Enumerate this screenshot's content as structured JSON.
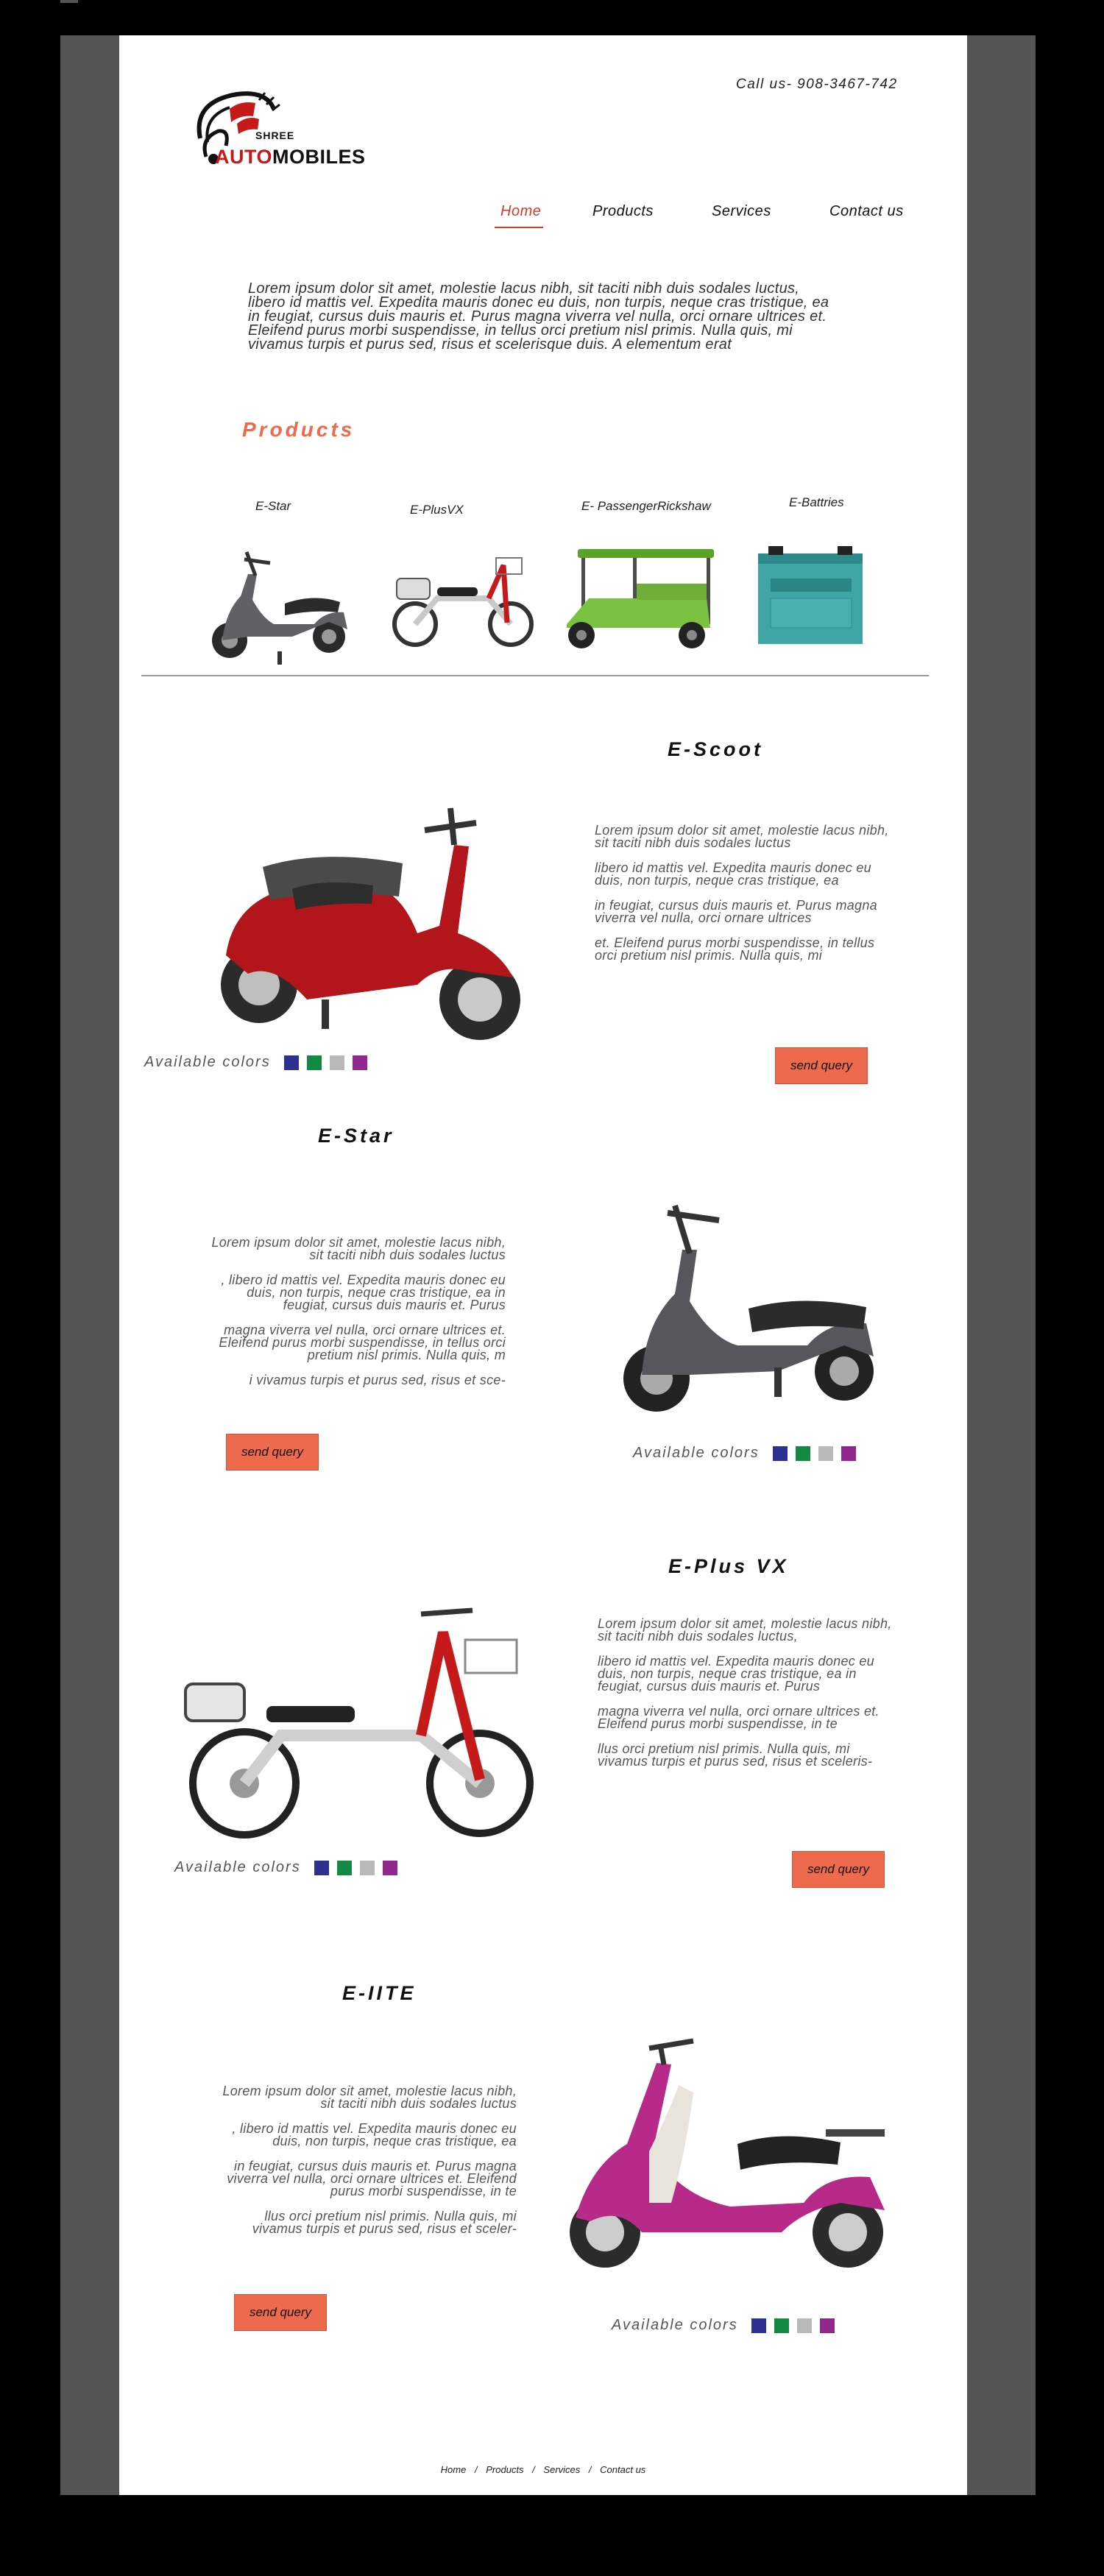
{
  "header": {
    "logo_top": "SHREE",
    "logo_main_red": "AUTO",
    "logo_main_rest": "MOBILES",
    "call": "Call us- 908-3467-742"
  },
  "nav": {
    "items": [
      "Home",
      "Products",
      "Services",
      "Contact us"
    ],
    "active": "Home"
  },
  "intro": "Lorem ipsum dolor sit amet, molestie lacus nibh, sit taciti nibh duis sodales luctus, libero id mattis vel. Expedita mauris donec eu duis, non turpis, neque cras tristique, ea in feugiat, cursus duis mauris et. Purus magna viverra vel nulla, orci ornare ultrices et. Eleifend purus morbi suspendisse, in tellus orci pretium nisl primis. Nulla quis, mi vivamus turpis et purus sed, risus et scelerisque duis. A elementum erat",
  "products": {
    "heading": "Products",
    "items": [
      {
        "label": "E-Star"
      },
      {
        "label": "E-PlusVX"
      },
      {
        "label": "E- PassengerRickshaw"
      },
      {
        "label": "E-Battries"
      }
    ]
  },
  "common": {
    "available_colors": "Available colors",
    "send_query": "send query",
    "swatch_colors": [
      "#2e3192",
      "#138a43",
      "#b9b9b9",
      "#92278f"
    ]
  },
  "sections": {
    "escoot": {
      "title": "E-Scoot",
      "paragraphs": [
        "Lorem ipsum dolor sit amet, molestie lacus nibh, sit taciti nibh duis sodales luctus",
        "libero id mattis vel. Expedita mauris donec eu duis, non turpis, neque cras tristique, ea",
        "in feugiat, cursus duis mauris et. Purus magna viverra vel nulla, orci ornare ultrices",
        "et. Eleifend purus morbi suspendisse, in tellus orci pretium nisl primis. Nulla quis, mi"
      ]
    },
    "estar": {
      "title": "E-Star",
      "paragraphs": [
        "Lorem ipsum dolor sit amet, molestie lacus nibh, sit taciti nibh duis sodales luctus",
        ", libero id mattis vel. Expedita mauris donec eu duis, non turpis, neque cras tristique, ea in feugiat, cursus duis mauris et. Purus",
        "magna viverra vel nulla, orci ornare ultrices et. Eleifend purus morbi suspendisse, in tellus orci pretium nisl primis. Nulla quis, m",
        "i vivamus turpis et purus sed, risus et sce-"
      ]
    },
    "eplusvx": {
      "title": "E-Plus VX",
      "paragraphs": [
        "Lorem ipsum dolor sit amet, molestie lacus nibh, sit taciti nibh duis sodales luctus,",
        "libero id mattis vel. Expedita mauris donec eu duis, non turpis, neque cras tristique, ea in feugiat, cursus duis mauris et. Purus",
        "magna viverra vel nulla, orci ornare ultrices et. Eleifend purus morbi suspendisse, in te",
        "llus orci pretium nisl primis. Nulla quis, mi vivamus turpis et purus sed, risus et sceleris-"
      ]
    },
    "eiite": {
      "title": "E-IITE",
      "paragraphs": [
        "Lorem ipsum dolor sit amet, molestie lacus nibh, sit taciti nibh duis sodales luctus",
        ", libero id mattis vel. Expedita mauris donec eu duis, non turpis, neque cras tristique, ea",
        "in feugiat, cursus duis mauris et. Purus magna viverra vel nulla, orci ornare ultrices et. Eleifend purus morbi suspendisse, in te",
        "llus orci pretium nisl primis. Nulla quis, mi vivamus turpis et purus sed, risus et sceler-"
      ]
    }
  },
  "footer": {
    "links": [
      "Home",
      "Products",
      "Services",
      "Contact us"
    ],
    "separator": "/"
  }
}
